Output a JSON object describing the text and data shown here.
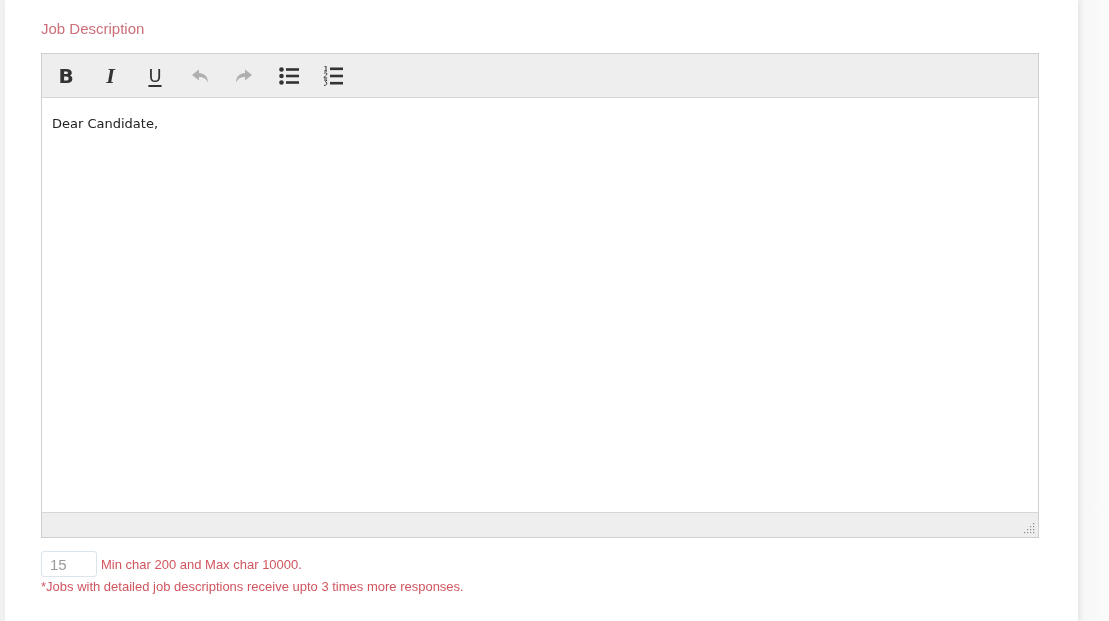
{
  "field": {
    "label": "Job Description"
  },
  "editor": {
    "toolbar": [
      {
        "kind": "bold",
        "label": "B",
        "disabled": false
      },
      {
        "kind": "italic",
        "label": "I",
        "disabled": false
      },
      {
        "kind": "underline",
        "label": "U",
        "disabled": false
      },
      {
        "kind": "undo",
        "disabled": true
      },
      {
        "kind": "redo",
        "disabled": true
      },
      {
        "kind": "bullet-list",
        "disabled": false
      },
      {
        "kind": "numbered-list",
        "disabled": false
      }
    ],
    "content": "Dear Candidate,"
  },
  "char_count": {
    "value": "15",
    "hint": "Min char 200 and Max char 10000."
  },
  "note": "*Jobs with detailed job descriptions receive upto 3 times more responses."
}
